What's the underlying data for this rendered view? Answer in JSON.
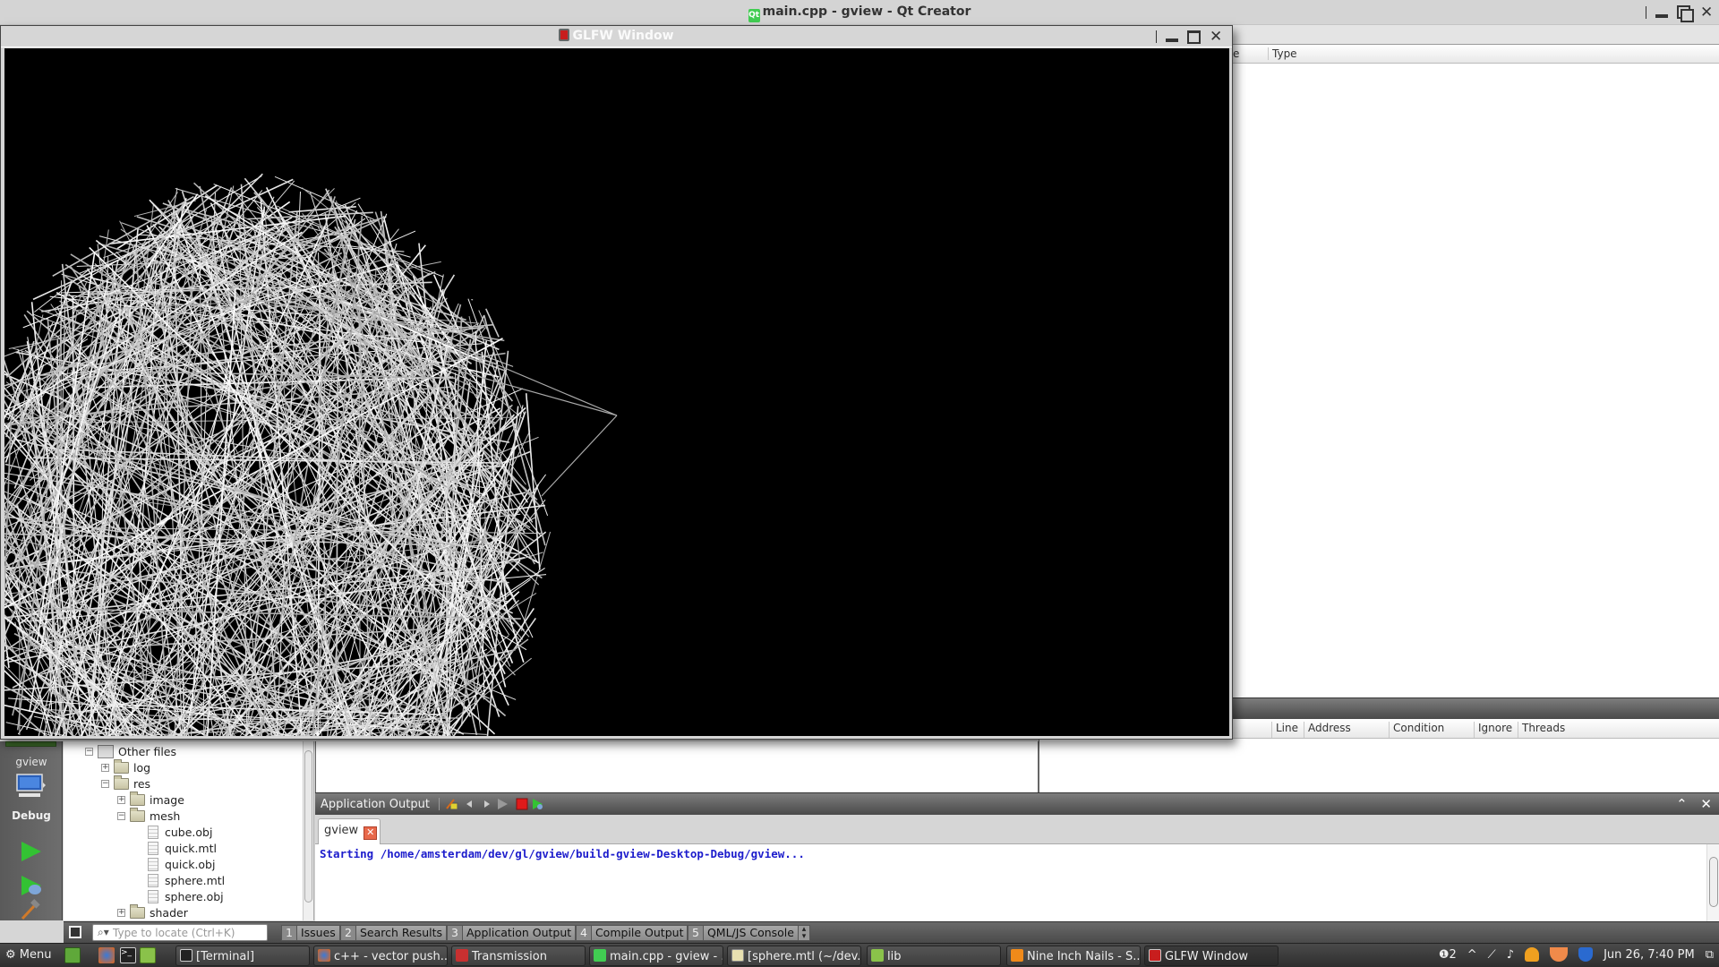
{
  "qt_creator": {
    "window_title": "main.cpp - gview - Qt Creator",
    "right_panel": {
      "columns": [
        "e",
        "Type"
      ]
    },
    "breakpoints": {
      "columns": [
        "Line",
        "Address",
        "Condition",
        "Ignore",
        "Threads"
      ]
    },
    "mode_bar": {
      "project": "gview",
      "config": "Debug",
      "icons": [
        "monitor-icon",
        "run-icon",
        "debug-run-icon",
        "build-hammer-icon"
      ]
    },
    "project_tree": {
      "items": [
        {
          "label": "Other files",
          "type": "project-group",
          "expanded": true
        },
        {
          "label": "log",
          "type": "folder",
          "expanded": false
        },
        {
          "label": "res",
          "type": "folder",
          "expanded": true
        },
        {
          "label": "image",
          "type": "folder",
          "expanded": false
        },
        {
          "label": "mesh",
          "type": "folder",
          "expanded": true
        },
        {
          "label": "cube.obj",
          "type": "file"
        },
        {
          "label": "quick.mtl",
          "type": "file"
        },
        {
          "label": "quick.obj",
          "type": "file"
        },
        {
          "label": "sphere.mtl",
          "type": "file"
        },
        {
          "label": "sphere.obj",
          "type": "file"
        },
        {
          "label": "shader",
          "type": "folder",
          "expanded": false
        }
      ]
    },
    "app_output": {
      "title": "Application Output",
      "tab_label": "gview",
      "text": "Starting /home/amsterdam/dev/gl/gview/build-gview-Desktop-Debug/gview..."
    },
    "locator": {
      "placeholder": "Type to locate (Ctrl+K)"
    },
    "pane_buttons": [
      {
        "num": "1",
        "label": "Issues"
      },
      {
        "num": "2",
        "label": "Search Results"
      },
      {
        "num": "3",
        "label": "Application Output"
      },
      {
        "num": "4",
        "label": "Compile Output"
      },
      {
        "num": "5",
        "label": "QML/JS Console"
      }
    ]
  },
  "glfw_window": {
    "title": "GLFW Window",
    "content": "wireframe sphere mesh render"
  },
  "taskbar": {
    "menu_label": "Menu",
    "tasks": [
      {
        "label": "[Terminal]",
        "icon": "terminal-icon"
      },
      {
        "label": "c++ - vector push...",
        "icon": "firefox-icon"
      },
      {
        "label": "Transmission",
        "icon": "transmission-icon"
      },
      {
        "label": "main.cpp - gview - ...",
        "icon": "qt-icon"
      },
      {
        "label": "[sphere.mtl (~/dev...",
        "icon": "text-editor-icon"
      },
      {
        "label": "lib",
        "icon": "folder-icon"
      },
      {
        "label": "Nine Inch Nails - S...",
        "icon": "music-player-icon"
      },
      {
        "label": "GLFW Window",
        "icon": "glfw-icon"
      }
    ],
    "tray": {
      "notifications": "2",
      "clock": "Jun 26,  7:40 PM"
    }
  }
}
